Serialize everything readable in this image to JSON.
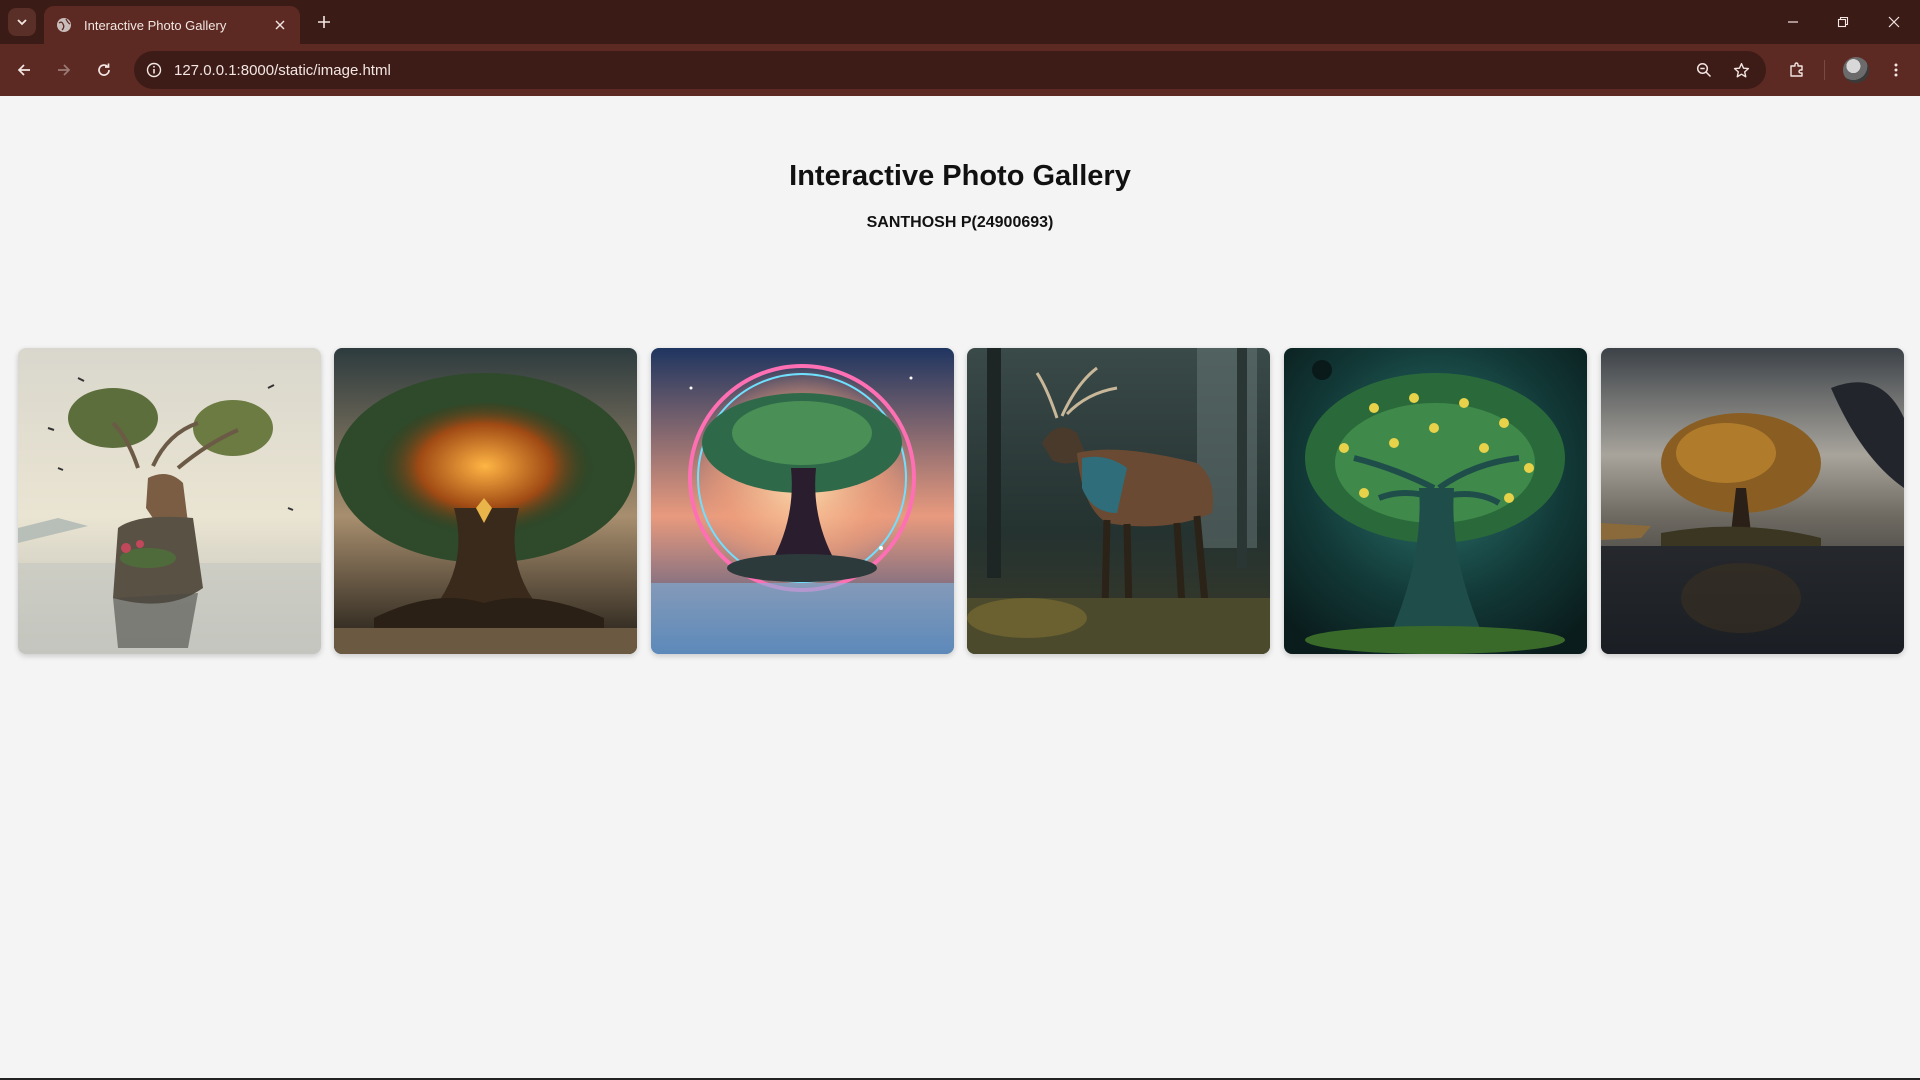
{
  "browser": {
    "tab_title": "Interactive Photo Gallery",
    "url": "127.0.0.1:8000/static/image.html",
    "icons": [
      "tab-search-icon",
      "globe-icon",
      "close-icon",
      "plus-icon",
      "minimize-icon",
      "restore-icon",
      "window-close-icon",
      "back-arrow-icon",
      "forward-arrow-icon",
      "reload-icon",
      "site-info-icon",
      "zoom-icon",
      "star-icon",
      "extensions-icon",
      "profile-avatar",
      "kebab-menu-icon"
    ],
    "colors": {
      "frame": "#3b1b16",
      "toolbar": "#5c2a22",
      "omnibox": "#3d1c17",
      "text": "#f3e6e3"
    }
  },
  "page": {
    "title": "Interactive Photo Gallery",
    "subtitle": "SANTHOSH P(24900693)",
    "background": "#f4f4f4"
  },
  "gallery": {
    "photos": [
      {
        "name": "photo-stag-with-tree-antlers"
      },
      {
        "name": "photo-glowing-great-tree"
      },
      {
        "name": "photo-cosmic-tree-in-halo"
      },
      {
        "name": "photo-stag-in-forest"
      },
      {
        "name": "photo-teal-tree-with-golden-fruit"
      },
      {
        "name": "photo-autumn-tree-on-island"
      }
    ]
  }
}
